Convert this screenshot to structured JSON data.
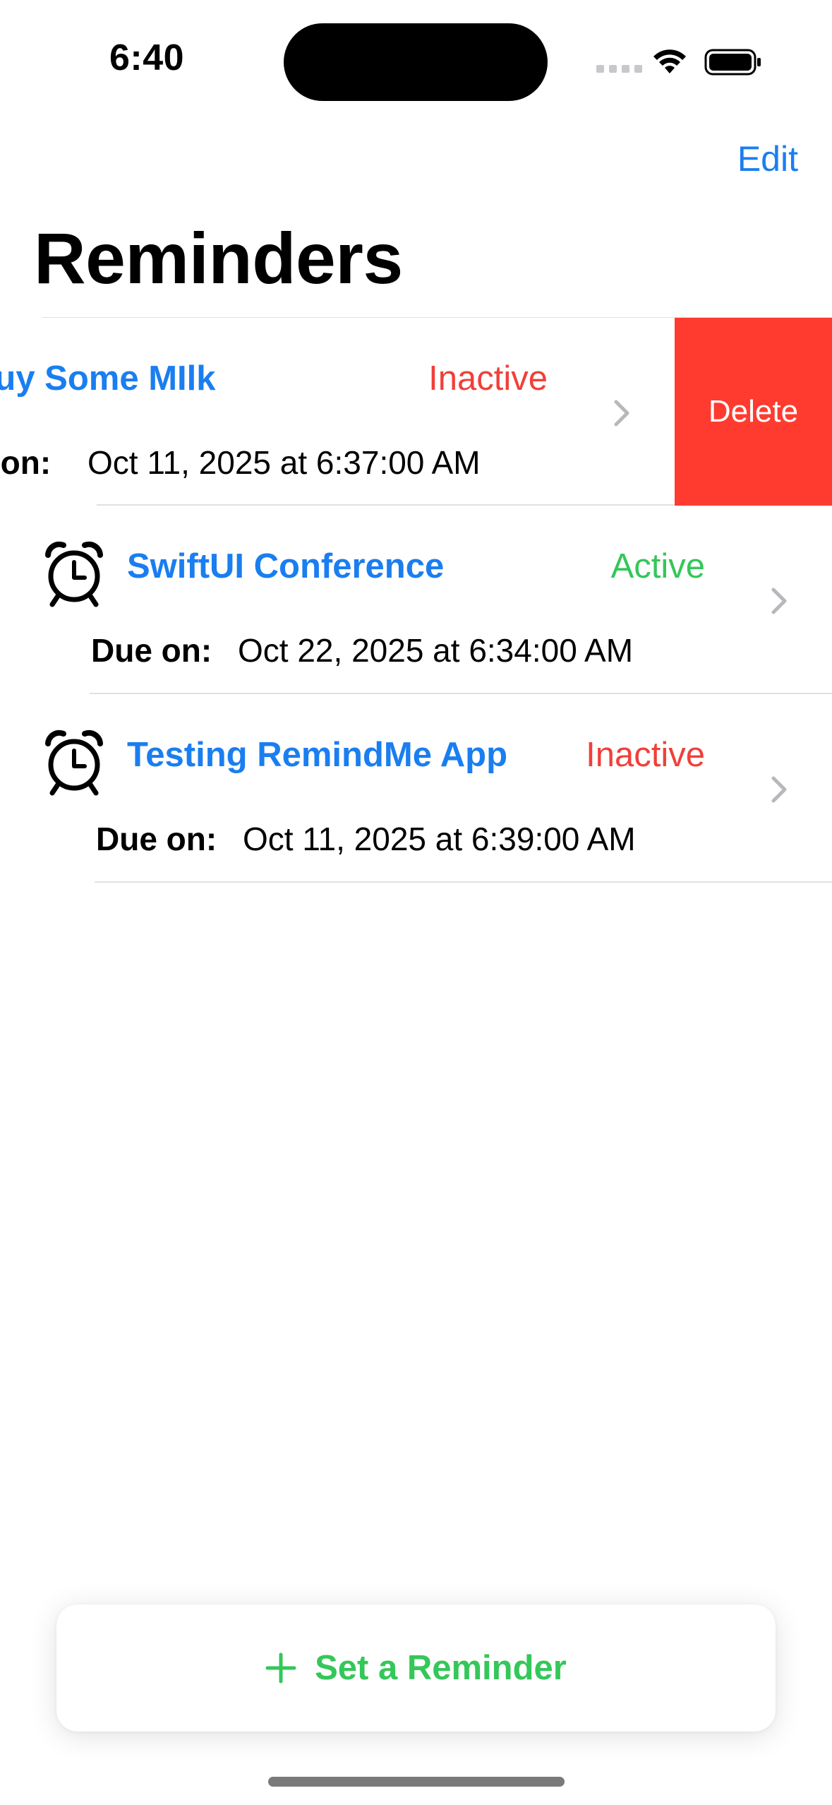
{
  "status_bar": {
    "time": "6:40"
  },
  "nav": {
    "edit_label": "Edit",
    "title": "Reminders"
  },
  "reminders": [
    {
      "title": "Buy Some MIlk",
      "status": "Inactive",
      "due_label": "Due on:",
      "due_date": "Oct 11, 2025 at 6:37:00 AM",
      "swiped": true
    },
    {
      "title": "SwiftUI Conference",
      "status": "Active",
      "due_label": "Due on:",
      "due_date": "Oct 22, 2025 at 6:34:00 AM",
      "swiped": false
    },
    {
      "title": "Testing RemindMe App",
      "status": "Inactive",
      "due_label": "Due on:",
      "due_date": "Oct 11, 2025 at 6:39:00 AM",
      "swiped": false
    }
  ],
  "swipe_action": {
    "delete_label": "Delete"
  },
  "footer": {
    "add_label": "Set a Reminder"
  },
  "colors": {
    "accent_blue": "#1a7ef0",
    "active_green": "#34c759",
    "inactive_red": "#f0403a",
    "delete_red": "#ff3b30"
  },
  "icons": {
    "row_icon": "alarm-icon",
    "row_accessory": "chevron-right-icon",
    "add_icon": "plus-icon"
  }
}
